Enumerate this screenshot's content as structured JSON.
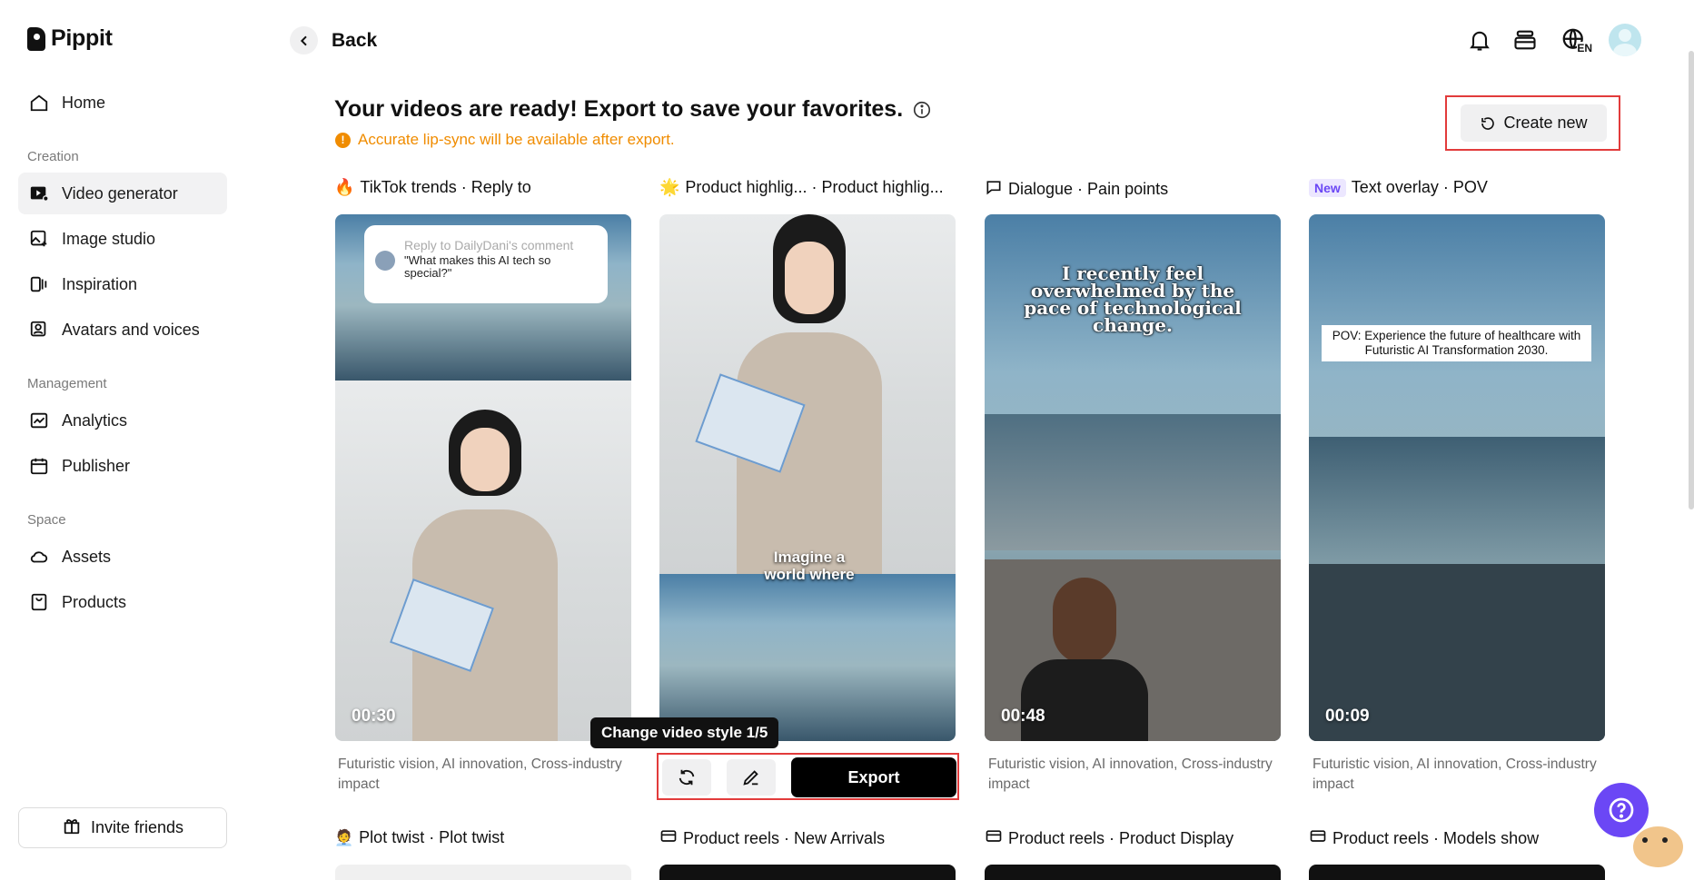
{
  "app": {
    "name": "Pippit"
  },
  "sidebar": {
    "items": [
      {
        "label": "Home"
      },
      {
        "label": "Video generator"
      },
      {
        "label": "Image studio"
      },
      {
        "label": "Inspiration"
      },
      {
        "label": "Avatars and voices"
      },
      {
        "label": "Analytics"
      },
      {
        "label": "Publisher"
      },
      {
        "label": "Assets"
      },
      {
        "label": "Products"
      }
    ],
    "sections": {
      "creation": "Creation",
      "management": "Management",
      "space": "Space"
    },
    "invite": "Invite friends"
  },
  "header": {
    "back": "Back",
    "lang": "EN"
  },
  "main": {
    "title": "Your videos are ready! Export to save your favorites.",
    "warning": "Accurate lip-sync will be available after export.",
    "create_new": "Create new",
    "cards": [
      {
        "label": "TikTok trends · Reply to",
        "duration": "00:30",
        "desc": "Futuristic vision, AI innovation, Cross-industry impact",
        "overlay": {
          "reply_to": "Reply to DailyDani's comment",
          "quote": "\"What makes this AI tech so special?\""
        }
      },
      {
        "label": "Product highlig... · Product highlig...",
        "caption": "Imagine a world where"
      },
      {
        "badge": "New",
        "label": "Dialogue · Pain points",
        "duration": "00:48",
        "desc": "Futuristic vision, AI innovation, Cross-industry impact",
        "caption": "I recently feel overwhelmed by the pace of technological change."
      },
      {
        "label": "Text overlay · POV",
        "duration": "00:09",
        "desc": "Futuristic vision, AI innovation, Cross-industry impact",
        "caption": "POV: Experience the future of healthcare with Futuristic AI Transformation 2030."
      }
    ],
    "tooltip": "Change video style 1/5",
    "export": "Export",
    "row2": [
      {
        "label": "Plot twist · Plot twist"
      },
      {
        "label": "Product reels · New Arrivals"
      },
      {
        "label": "Product reels · Product Display"
      },
      {
        "label": "Product reels · Models show"
      }
    ]
  }
}
